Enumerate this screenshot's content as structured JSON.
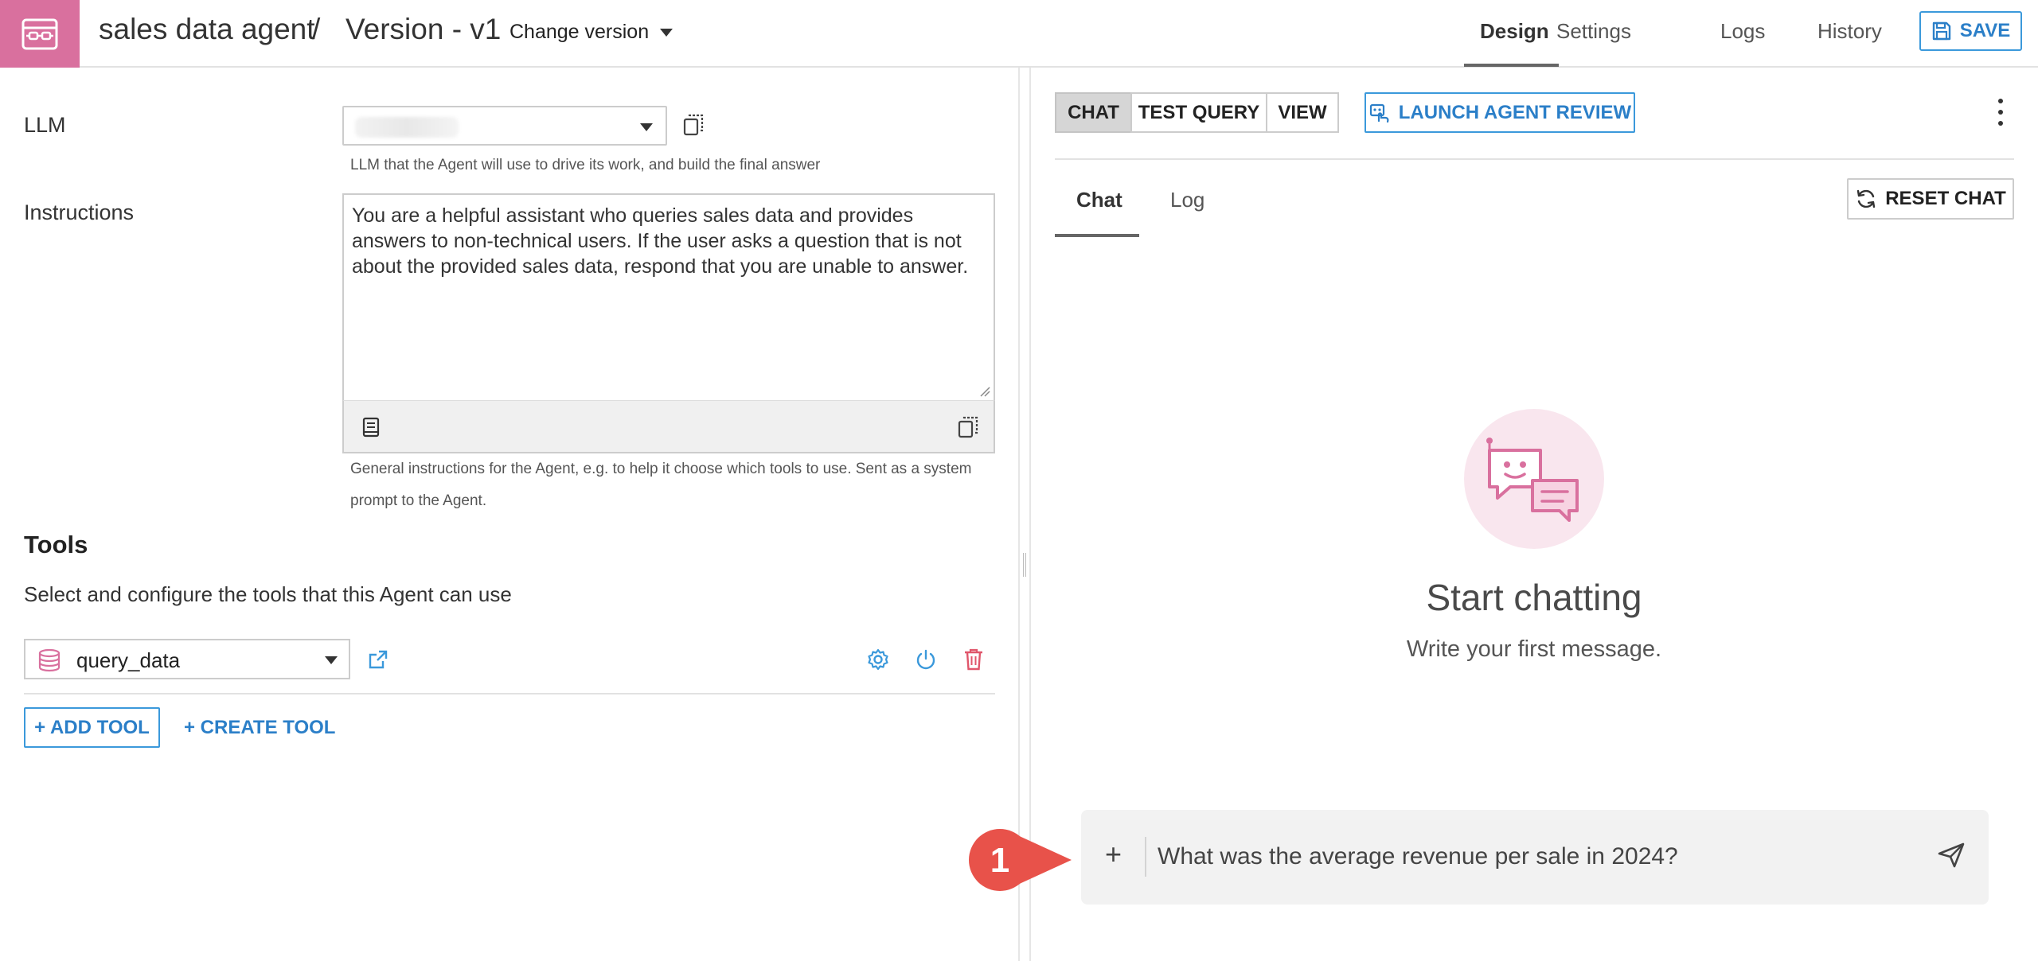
{
  "header": {
    "agent_name": "sales data agent",
    "separator": "/",
    "version_name": "Version - v1",
    "change_version_label": "Change version",
    "tabs": [
      {
        "label": "Design",
        "active": true
      },
      {
        "label": "Settings",
        "active": false
      },
      {
        "label": "Logs",
        "active": false
      },
      {
        "label": "History",
        "active": false
      }
    ],
    "save_label": "SAVE"
  },
  "config": {
    "llm_label": "LLM",
    "llm_help": "LLM that the Agent will use to drive its work, and build the final answer",
    "instructions_label": "Instructions",
    "instructions_value": "You are a helpful assistant who queries sales data and provides answers to non-technical users. If the user asks a question that is not about the provided sales data, respond that you are unable to answer.",
    "instructions_help": "General instructions for the Agent, e.g. to help it choose which tools to use. Sent as a system prompt to the Agent."
  },
  "tools": {
    "title": "Tools",
    "subtitle": "Select and configure the tools that this Agent can use",
    "selected_tool": "query_data",
    "add_tool_label": "+ ADD TOOL",
    "create_tool_label": "+ CREATE TOOL"
  },
  "right_panel": {
    "modes": [
      {
        "label": "CHAT",
        "active": true
      },
      {
        "label": "TEST QUERY",
        "active": false
      },
      {
        "label": "VIEW",
        "active": false
      }
    ],
    "launch_review_label": "LAUNCH AGENT REVIEW",
    "subtabs": [
      {
        "label": "Chat",
        "active": true
      },
      {
        "label": "Log",
        "active": false
      }
    ],
    "reset_chat_label": "RESET CHAT",
    "empty_title": "Start chatting",
    "empty_subtitle": "Write your first message.",
    "composer_value": "What was the average revenue per sale in 2024?",
    "callout_number": "1"
  },
  "colors": {
    "accent_blue": "#2b7fc8",
    "brand_pink": "#d9709e",
    "callout_red": "#e8524a"
  }
}
